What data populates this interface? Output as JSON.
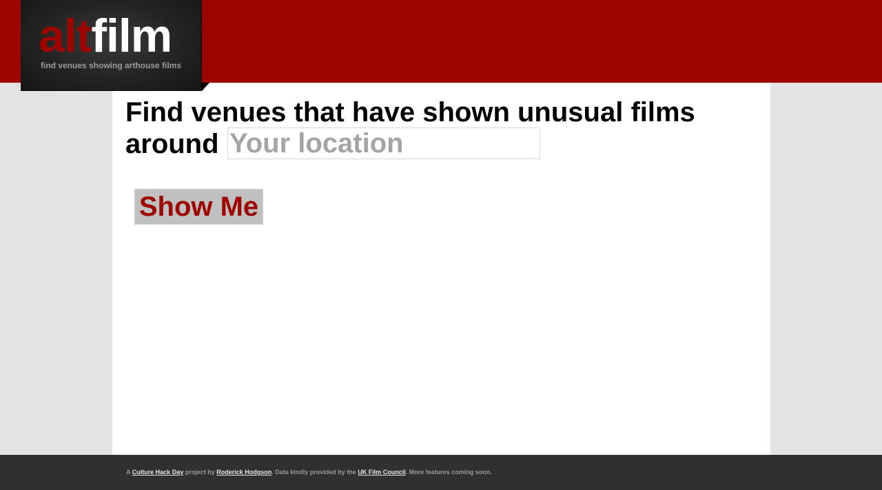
{
  "brand": {
    "name_part1": "alt",
    "name_part2": "film",
    "tagline": "find venues showing arthouse films",
    "colors": {
      "header_red": "#9d0600",
      "logo_dark": "#232323",
      "button_gray": "#c0c0c0",
      "footer_dark": "#303030"
    }
  },
  "main": {
    "headline": "Find venues that have shown unusual films",
    "around_label": "around",
    "location_input": {
      "value": "",
      "placeholder": "Your location"
    },
    "submit_label": "Show Me"
  },
  "footer": {
    "prefix": "A ",
    "link1": "Culture Hack Day",
    "text1": " project by ",
    "link2": "Roderick Hodgson",
    "text2": ". Data kindly provided by the ",
    "link3": "UK Film Council",
    "text3": ". More features coming soon."
  }
}
